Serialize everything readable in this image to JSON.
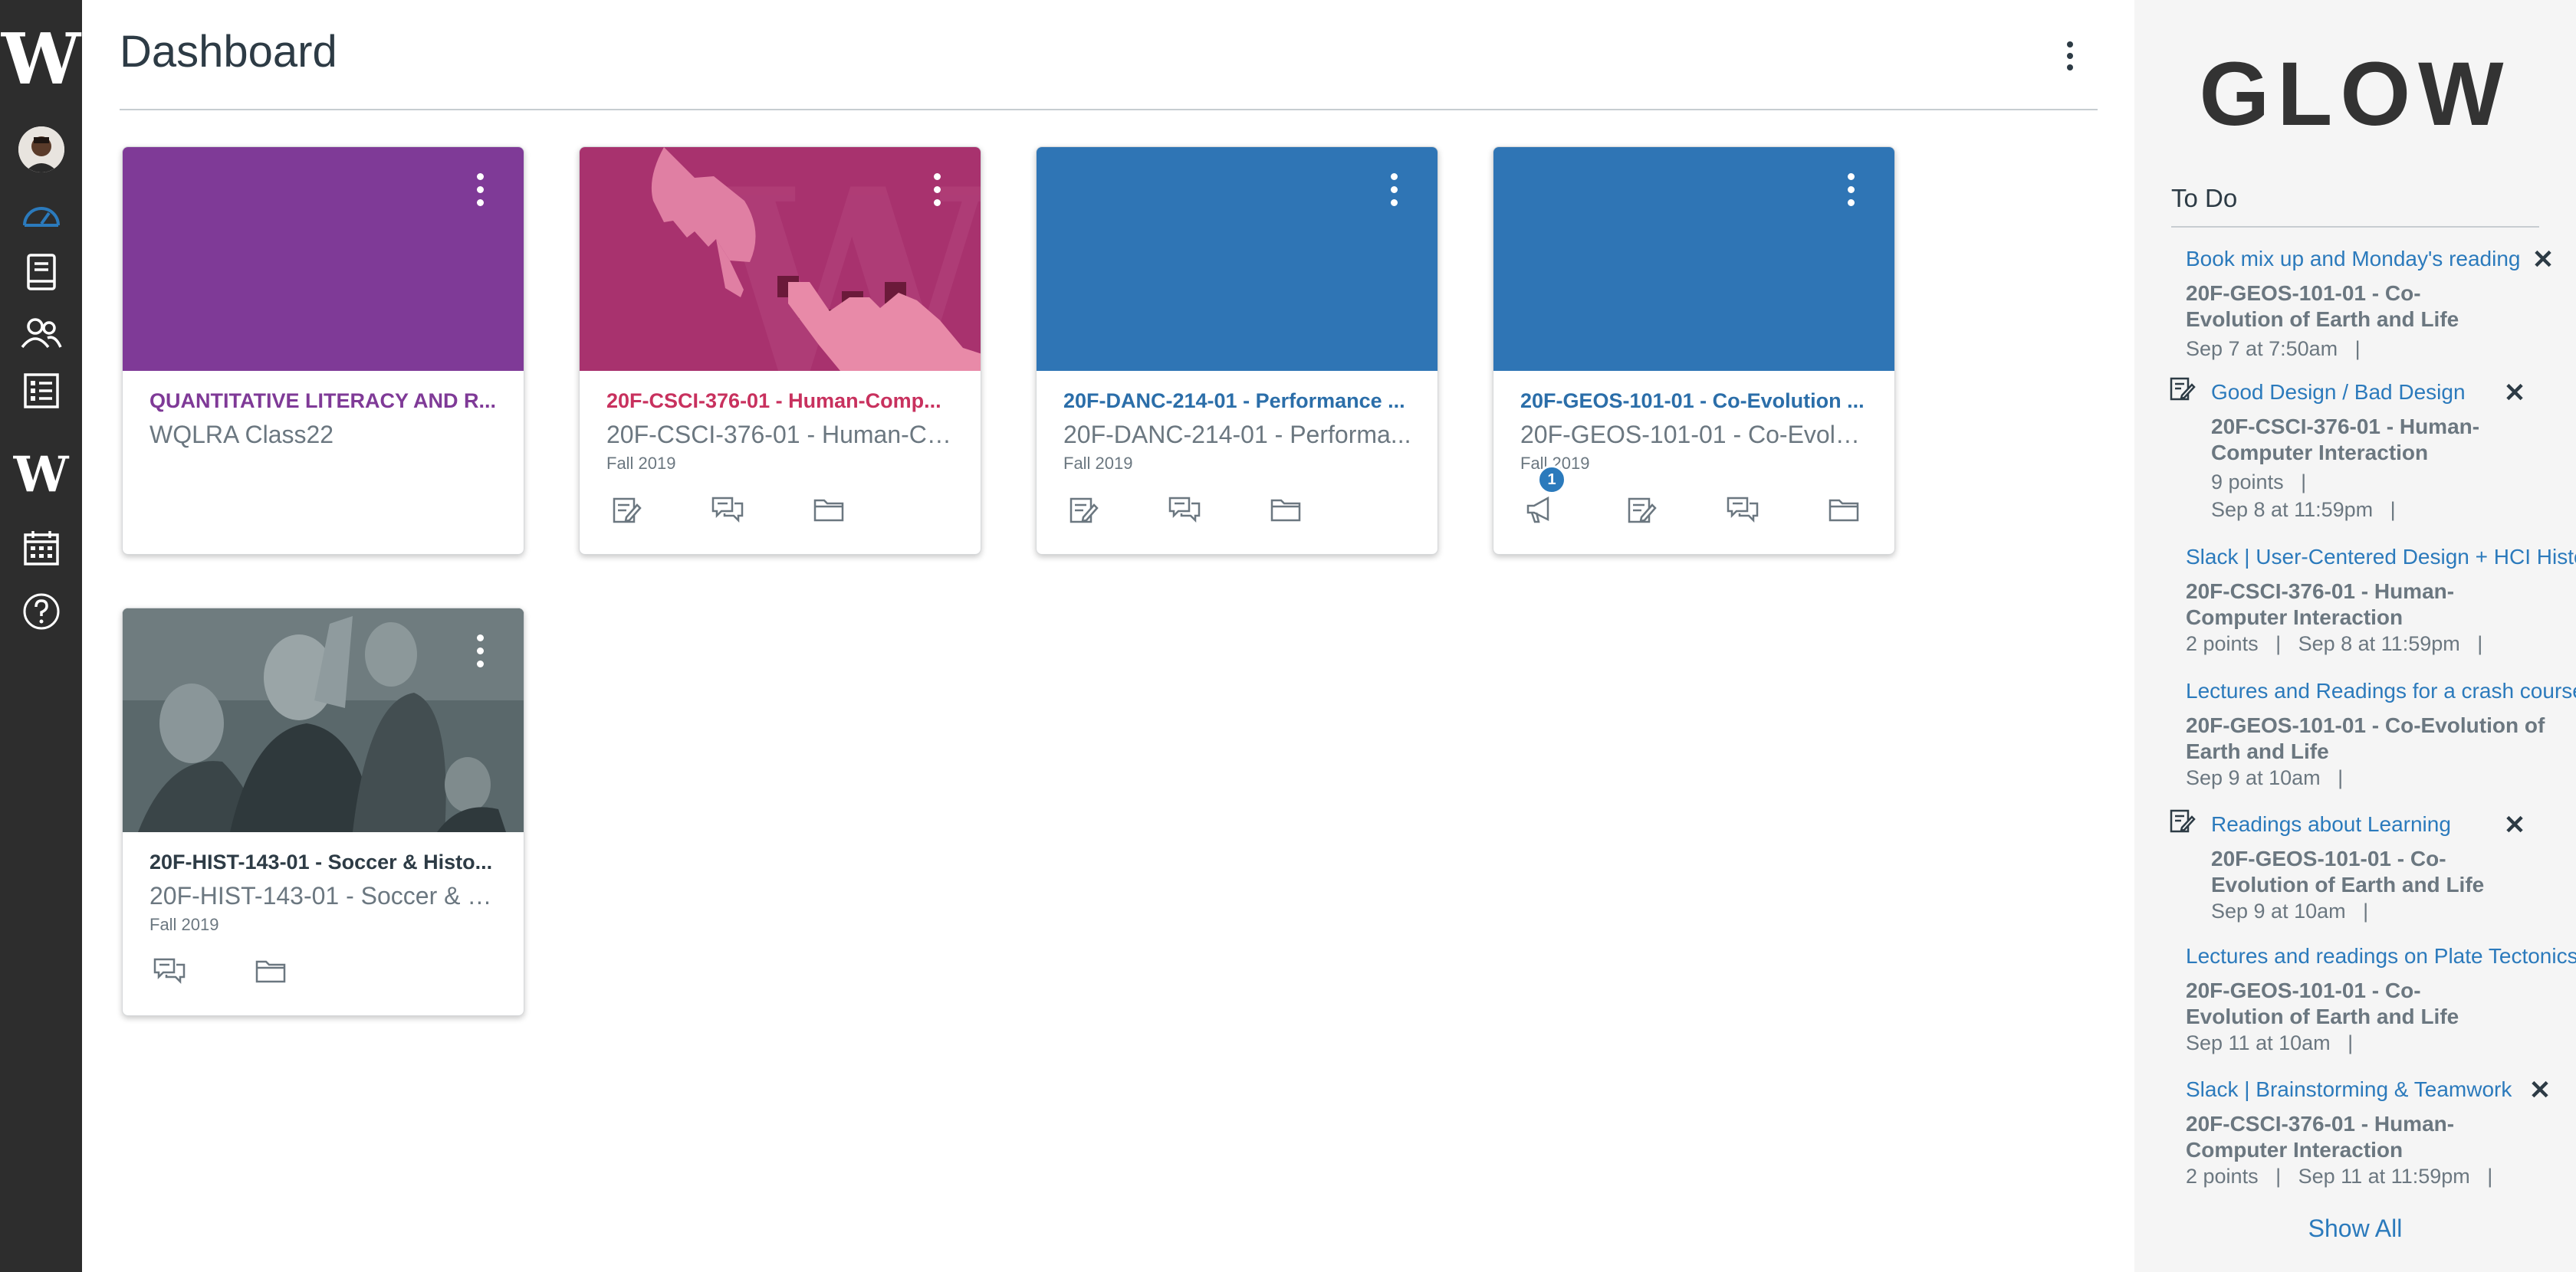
{
  "nav": {
    "logo_letter": "W",
    "logo2_letter": "W",
    "icons": [
      "avatar",
      "dashboard-icon",
      "courses-icon",
      "groups-icon",
      "assignments-icon",
      "w-logo",
      "calendar-icon",
      "help-icon"
    ],
    "active": "dashboard"
  },
  "header": {
    "title": "Dashboard"
  },
  "cards": [
    {
      "title": "QUANTITATIVE LITERACY AND R...",
      "subtitle": "WQLRA Class22",
      "term": "",
      "color": "#7f3a97",
      "title_color": "#7f3a97",
      "icons": []
    },
    {
      "title": "20F-CSCI-376-01 - Human-Comp...",
      "subtitle": "20F-CSCI-376-01 - Human-Co...",
      "term": "Fall 2019",
      "color": "#a8326e",
      "title_color": "#c8315e",
      "icons": [
        "assignments-icon",
        "discussions-icon",
        "files-icon"
      ]
    },
    {
      "title": "20F-DANC-214-01 - Performance ...",
      "subtitle": "20F-DANC-214-01 - Performa...",
      "term": "Fall 2019",
      "color": "#2f75b5",
      "title_color": "#2b6ea9",
      "icons": [
        "assignments-icon",
        "discussions-icon",
        "files-icon"
      ]
    },
    {
      "title": "20F-GEOS-101-01 - Co-Evolution ...",
      "subtitle": "20F-GEOS-101-01 - Co-Evolu...",
      "term": "Fall 2019",
      "color": "#2f75b5",
      "title_color": "#2b6ea9",
      "icons": [
        "announcements-icon",
        "assignments-icon",
        "discussions-icon",
        "files-icon"
      ],
      "badge": "1"
    },
    {
      "title": "20F-HIST-143-01 - Soccer & Histo...",
      "subtitle": "20F-HIST-143-01 - Soccer & H...",
      "term": "Fall 2019",
      "color": "#4d5c60",
      "title_color": "#2d3b45",
      "icons": [
        "discussions-icon",
        "files-icon"
      ]
    }
  ],
  "sidebar": {
    "brand": "GLOW",
    "todo_heading": "To Do",
    "show_all": "Show All",
    "todos": [
      {
        "title": "Book mix up and Monday's reading",
        "course": "20F-GEOS-101-01 - Co-Evolution of Earth and Life",
        "meta": "Sep 7 at 7:50am   |",
        "has_icon": false,
        "dismissable": true
      },
      {
        "title": "Good Design / Bad Design",
        "course": "20F-CSCI-376-01 - Human-Computer Interaction",
        "meta": "9 points   |",
        "meta2": "Sep 8 at 11:59pm   |",
        "has_icon": true,
        "dismissable": true
      },
      {
        "title": "Slack | User-Centered Design + HCI History",
        "course": "20F-CSCI-376-01 - Human-Computer Interaction",
        "meta": "2 points   |   Sep 8 at 11:59pm   |",
        "has_icon": false,
        "dismissable": false
      },
      {
        "title": "Lectures and Readings for a crash course in",
        "course": "20F-GEOS-101-01 - Co-Evolution of Earth and Life",
        "meta": "Sep 9 at 10am   |",
        "has_icon": false,
        "dismissable": false
      },
      {
        "title": "Readings about Learning",
        "course": "20F-GEOS-101-01 - Co-Evolution of Earth and Life",
        "meta": "Sep 9 at 10am   |",
        "has_icon": true,
        "dismissable": true
      },
      {
        "title": "Lectures and readings on Plate Tectonics",
        "course": "20F-GEOS-101-01 - Co-Evolution of Earth and Life",
        "meta": "Sep 11 at 10am   |",
        "has_icon": false,
        "dismissable": false
      },
      {
        "title": "Slack | Brainstorming & Teamwork",
        "course": "20F-CSCI-376-01 - Human-Computer Interaction",
        "meta": "2 points   |   Sep 11 at 11:59pm   |",
        "has_icon": false,
        "dismissable": true
      }
    ]
  }
}
